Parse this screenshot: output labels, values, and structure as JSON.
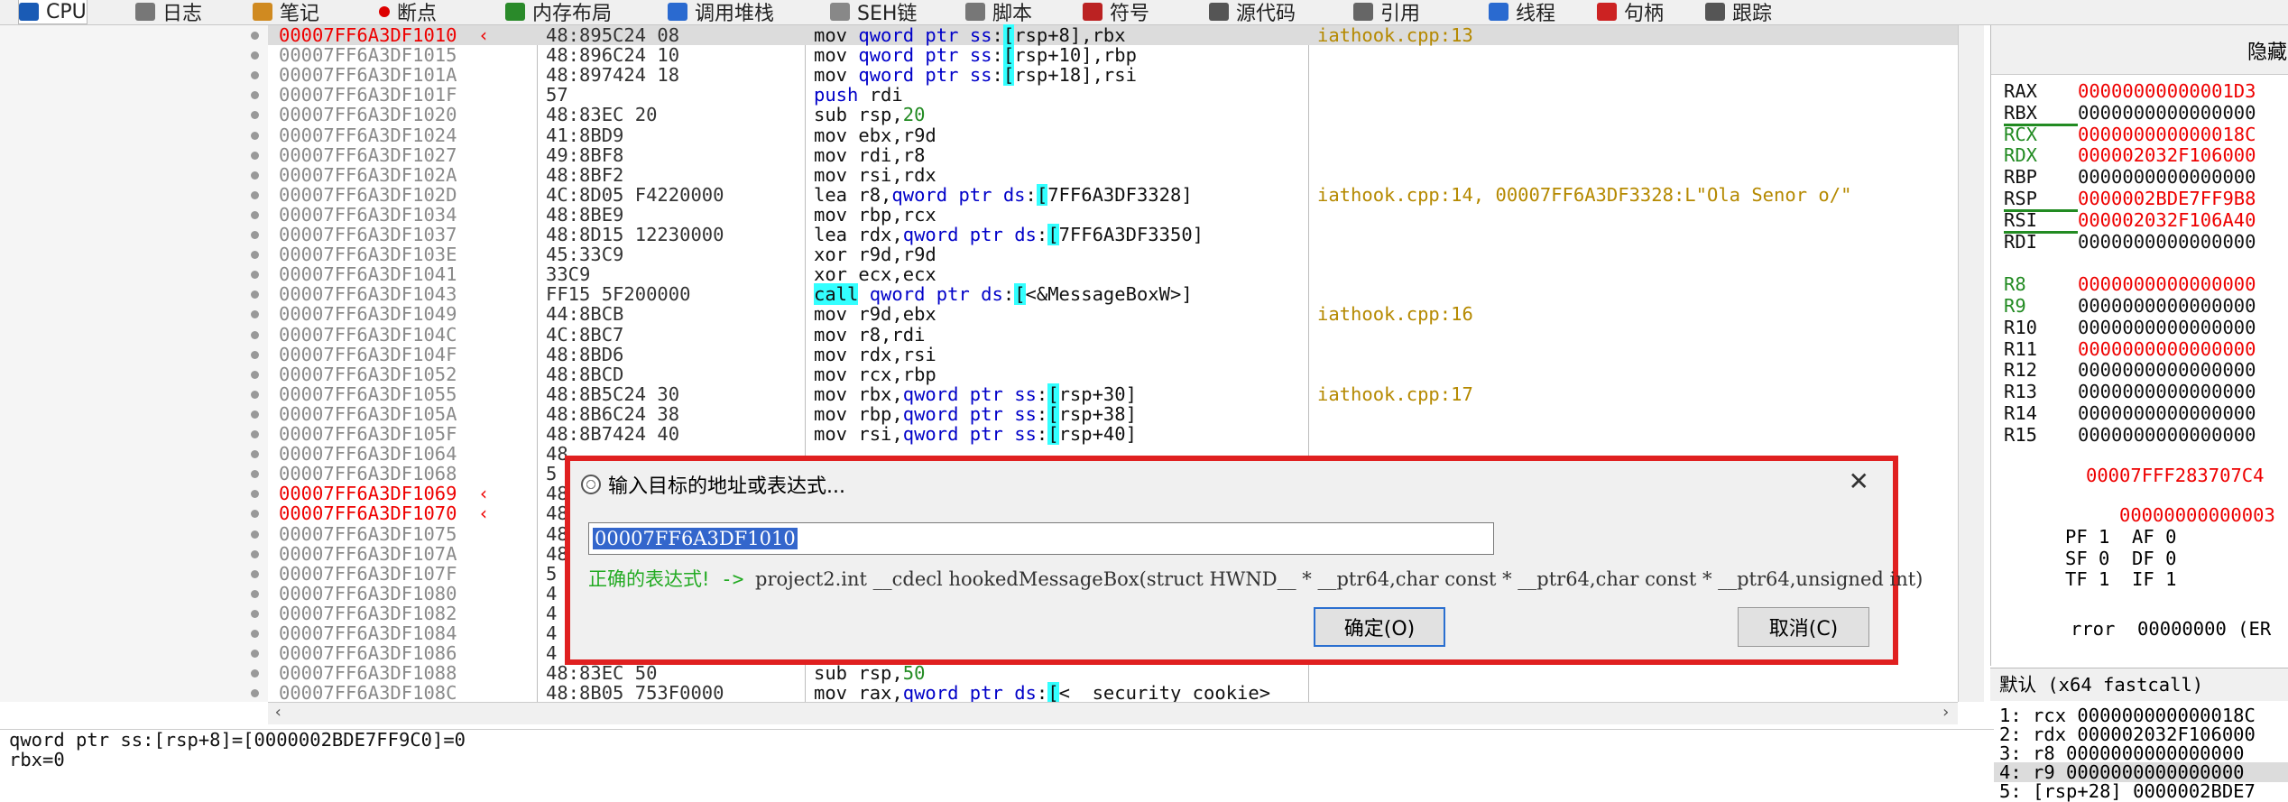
{
  "tabs": [
    {
      "label": "CPU",
      "icon": "cpu-icon",
      "active": true
    },
    {
      "label": "笔记",
      "icon": "notes-icon"
    },
    {
      "label": "断点",
      "icon": "breakpoint-icon"
    },
    {
      "label": "内存布局",
      "icon": "memory-map-icon"
    },
    {
      "label": "调用堆栈",
      "icon": "call-stack-icon"
    },
    {
      "label": "SEH链",
      "icon": "seh-icon"
    },
    {
      "label": "脚本",
      "icon": "script-icon"
    },
    {
      "label": "符号",
      "icon": "symbol-icon"
    },
    {
      "label": "源代码",
      "icon": "source-icon"
    },
    {
      "label": "引用",
      "icon": "reference-icon"
    },
    {
      "label": "线程",
      "icon": "thread-icon"
    },
    {
      "label": "句柄",
      "icon": "handle-icon"
    },
    {
      "label": "跟踪",
      "icon": "trace-icon"
    }
  ],
  "log_tab_label": "日志",
  "listing": [
    {
      "addr": "00007FF6A3DF1010",
      "red": true,
      "sel": true,
      "arrow": "‹",
      "bytes": "48:895C24 08",
      "asm": "mov qword ptr ss:[rsp+8],rbx",
      "cmt": "iathook.cpp:13"
    },
    {
      "addr": "00007FF6A3DF1015",
      "bytes": "48:896C24 10",
      "asm": "mov qword ptr ss:[rsp+10],rbp",
      "cmt": ""
    },
    {
      "addr": "00007FF6A3DF101A",
      "bytes": "48:897424 18",
      "asm": "mov qword ptr ss:[rsp+18],rsi",
      "cmt": ""
    },
    {
      "addr": "00007FF6A3DF101F",
      "bytes": "57",
      "asm": "push rdi",
      "cmt": ""
    },
    {
      "addr": "00007FF6A3DF1020",
      "bytes": "48:83EC 20",
      "asm": "sub rsp,20",
      "cmt": ""
    },
    {
      "addr": "00007FF6A3DF1024",
      "bytes": "41:8BD9",
      "asm": "mov ebx,r9d",
      "cmt": ""
    },
    {
      "addr": "00007FF6A3DF1027",
      "bytes": "49:8BF8",
      "asm": "mov rdi,r8",
      "cmt": ""
    },
    {
      "addr": "00007FF6A3DF102A",
      "bytes": "48:8BF2",
      "asm": "mov rsi,rdx",
      "cmt": ""
    },
    {
      "addr": "00007FF6A3DF102D",
      "bytes": "4C:8D05 F4220000",
      "asm": "lea r8,qword ptr ds:[7FF6A3DF3328]",
      "cmt": "iathook.cpp:14, 00007FF6A3DF3328:L\"Ola Senor o/\""
    },
    {
      "addr": "00007FF6A3DF1034",
      "bytes": "48:8BE9",
      "asm": "mov rbp,rcx",
      "cmt": ""
    },
    {
      "addr": "00007FF6A3DF1037",
      "bytes": "48:8D15 12230000",
      "asm": "lea rdx,qword ptr ds:[7FF6A3DF3350]",
      "cmt": ""
    },
    {
      "addr": "00007FF6A3DF103E",
      "bytes": "45:33C9",
      "asm": "xor r9d,r9d",
      "cmt": ""
    },
    {
      "addr": "00007FF6A3DF1041",
      "bytes": "33C9",
      "asm": "xor ecx,ecx",
      "cmt": ""
    },
    {
      "addr": "00007FF6A3DF1043",
      "bytes": "FF15 5F200000",
      "asm": "call qword ptr ds:[<&MessageBoxW>]",
      "cmt": ""
    },
    {
      "addr": "00007FF6A3DF1049",
      "bytes": "44:8BCB",
      "asm": "mov r9d,ebx",
      "cmt": "iathook.cpp:16"
    },
    {
      "addr": "00007FF6A3DF104C",
      "bytes": "4C:8BC7",
      "asm": "mov r8,rdi",
      "cmt": ""
    },
    {
      "addr": "00007FF6A3DF104F",
      "bytes": "48:8BD6",
      "asm": "mov rdx,rsi",
      "cmt": ""
    },
    {
      "addr": "00007FF6A3DF1052",
      "bytes": "48:8BCD",
      "asm": "mov rcx,rbp",
      "cmt": ""
    },
    {
      "addr": "00007FF6A3DF1055",
      "bytes": "48:8B5C24 30",
      "asm": "mov rbx,qword ptr ss:[rsp+30]",
      "cmt": "iathook.cpp:17"
    },
    {
      "addr": "00007FF6A3DF105A",
      "bytes": "48:8B6C24 38",
      "asm": "mov rbp,qword ptr ss:[rsp+38]",
      "cmt": ""
    },
    {
      "addr": "00007FF6A3DF105F",
      "bytes": "48:8B7424 40",
      "asm": "mov rsi,qword ptr ss:[rsp+40]",
      "cmt": ""
    },
    {
      "addr": "00007FF6A3DF1064",
      "bytes": "48",
      "asm": "",
      "cmt": ""
    },
    {
      "addr": "00007FF6A3DF1068",
      "bytes": "5",
      "asm": "",
      "cmt": ""
    },
    {
      "addr": "00007FF6A3DF1069",
      "red": true,
      "arrow": "‹",
      "bytes": "48",
      "asm": "",
      "cmt": ""
    },
    {
      "addr": "00007FF6A3DF1070",
      "red": true,
      "arrow": "‹",
      "bytes": "48",
      "asm": "",
      "cmt": ""
    },
    {
      "addr": "00007FF6A3DF1075",
      "bytes": "48",
      "asm": "",
      "cmt": ""
    },
    {
      "addr": "00007FF6A3DF107A",
      "bytes": "48",
      "asm": "",
      "cmt": ""
    },
    {
      "addr": "00007FF6A3DF107F",
      "bytes": "5",
      "asm": "",
      "cmt": ""
    },
    {
      "addr": "00007FF6A3DF1080",
      "bytes": "4",
      "asm": "",
      "cmt": ""
    },
    {
      "addr": "00007FF6A3DF1082",
      "bytes": "4",
      "asm": "",
      "cmt": ""
    },
    {
      "addr": "00007FF6A3DF1084",
      "bytes": "4",
      "asm": "",
      "cmt": ""
    },
    {
      "addr": "00007FF6A3DF1086",
      "bytes": "4",
      "asm": "",
      "cmt": ""
    },
    {
      "addr": "00007FF6A3DF1088",
      "bytes": "48:83EC 50",
      "asm": "sub rsp,50",
      "cmt": ""
    },
    {
      "addr": "00007FF6A3DF108C",
      "bytes": "48:8B05 753F0000",
      "asm": "mov rax,qword ptr ds:[<__security_cookie>",
      "cmt": ""
    }
  ],
  "registers": {
    "header_label": "隐藏",
    "items": [
      {
        "name": "RAX",
        "value": "00000000000001D3",
        "red": true
      },
      {
        "name": "RBX",
        "value": "0000000000000000",
        "ul": true
      },
      {
        "name": "RCX",
        "value": "000000000000018C",
        "red": true,
        "green": true
      },
      {
        "name": "RDX",
        "value": "000002032F106000",
        "red": true,
        "green": true
      },
      {
        "name": "RBP",
        "value": "0000000000000000"
      },
      {
        "name": "RSP",
        "value": "0000002BDE7FF9B8",
        "red": true,
        "ul": true
      },
      {
        "name": "RSI",
        "value": "000002032F106A40",
        "red": true,
        "ul": true
      },
      {
        "name": "RDI",
        "value": "0000000000000000"
      },
      {
        "name": "",
        "value": ""
      },
      {
        "name": "R8",
        "value": "0000000000000000",
        "red": true,
        "green": true
      },
      {
        "name": "R9",
        "value": "0000000000000000",
        "green": true
      },
      {
        "name": "R10",
        "value": "0000000000000000"
      },
      {
        "name": "R11",
        "value": "0000000000000000",
        "red": true
      },
      {
        "name": "R12",
        "value": "0000000000000000"
      },
      {
        "name": "R13",
        "value": "0000000000000000"
      },
      {
        "name": "R14",
        "value": "0000000000000000"
      },
      {
        "name": "R15",
        "value": "0000000000000000"
      }
    ],
    "rip_value": "00007FFF283707C4",
    "rflags_value": "00000000000003",
    "flags": [
      {
        "row": "PF 1  AF 0"
      },
      {
        "row": "SF 0  DF 0"
      },
      {
        "row": "TF 1  IF 1"
      }
    ],
    "lasterror_row": "rror  00000000 (ER"
  },
  "call_convention": "默认 (x64 fastcall)",
  "stack_args": [
    "1: rcx 000000000000018C",
    "2: rdx 000002032F106000",
    "3: r8 0000000000000000",
    "4: r9 0000000000000000",
    "5: [rsp+28] 0000002BDE7"
  ],
  "info": {
    "line1": "qword ptr ss:[rsp+8]=[0000002BDE7FF9C0]=0",
    "line2": "rbx=0"
  },
  "dialog": {
    "title": "输入目标的地址或表达式...",
    "input_value": "00007FF6A3DF1010",
    "status_ok": "正确的表达式!",
    "status_arrow": " -> ",
    "status_signature": "project2.int __cdecl hookedMessageBox(struct HWND__ * __ptr64,char const * __ptr64,char const * __ptr64,unsigned int)",
    "ok_label": "确定(O)",
    "cancel_label": "取消(C)"
  },
  "colors": {
    "accent_red": "#e02020",
    "highlight_yellow": "#ffff55",
    "highlight_cyan": "#33ffff",
    "address_red": "#e00000"
  }
}
